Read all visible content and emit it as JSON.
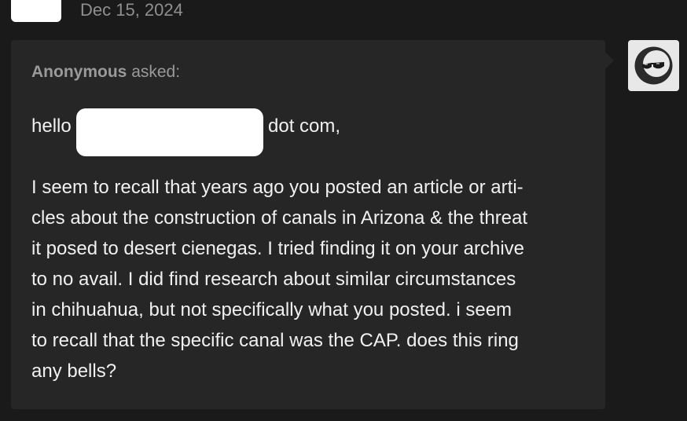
{
  "post": {
    "date": "Dec 15, 2024"
  },
  "ask": {
    "asker_name": "Anonymous",
    "asked_label": "asked:",
    "greeting_prefix": "hello",
    "greeting_suffix": "dot com,",
    "body_lines": [
      "I seem to recall that years ago you posted an article or arti-",
      "cles about the construction of canals in Arizona & the threat",
      "it posed to desert cienegas. I tried finding it on your archive",
      "to no avail. I did find research about similar circumstances",
      "in chihuahua, but not specifically what you posted. i seem",
      "to recall that the specific canal was the CAP. does this ring",
      "any bells?"
    ]
  },
  "colors": {
    "background": "#1a1a1a",
    "card": "#262626",
    "text": "#f0f0f0",
    "muted": "#8f8f8f"
  },
  "icons": {
    "anonymous_avatar": "anonymous-sunglasses-icon"
  }
}
